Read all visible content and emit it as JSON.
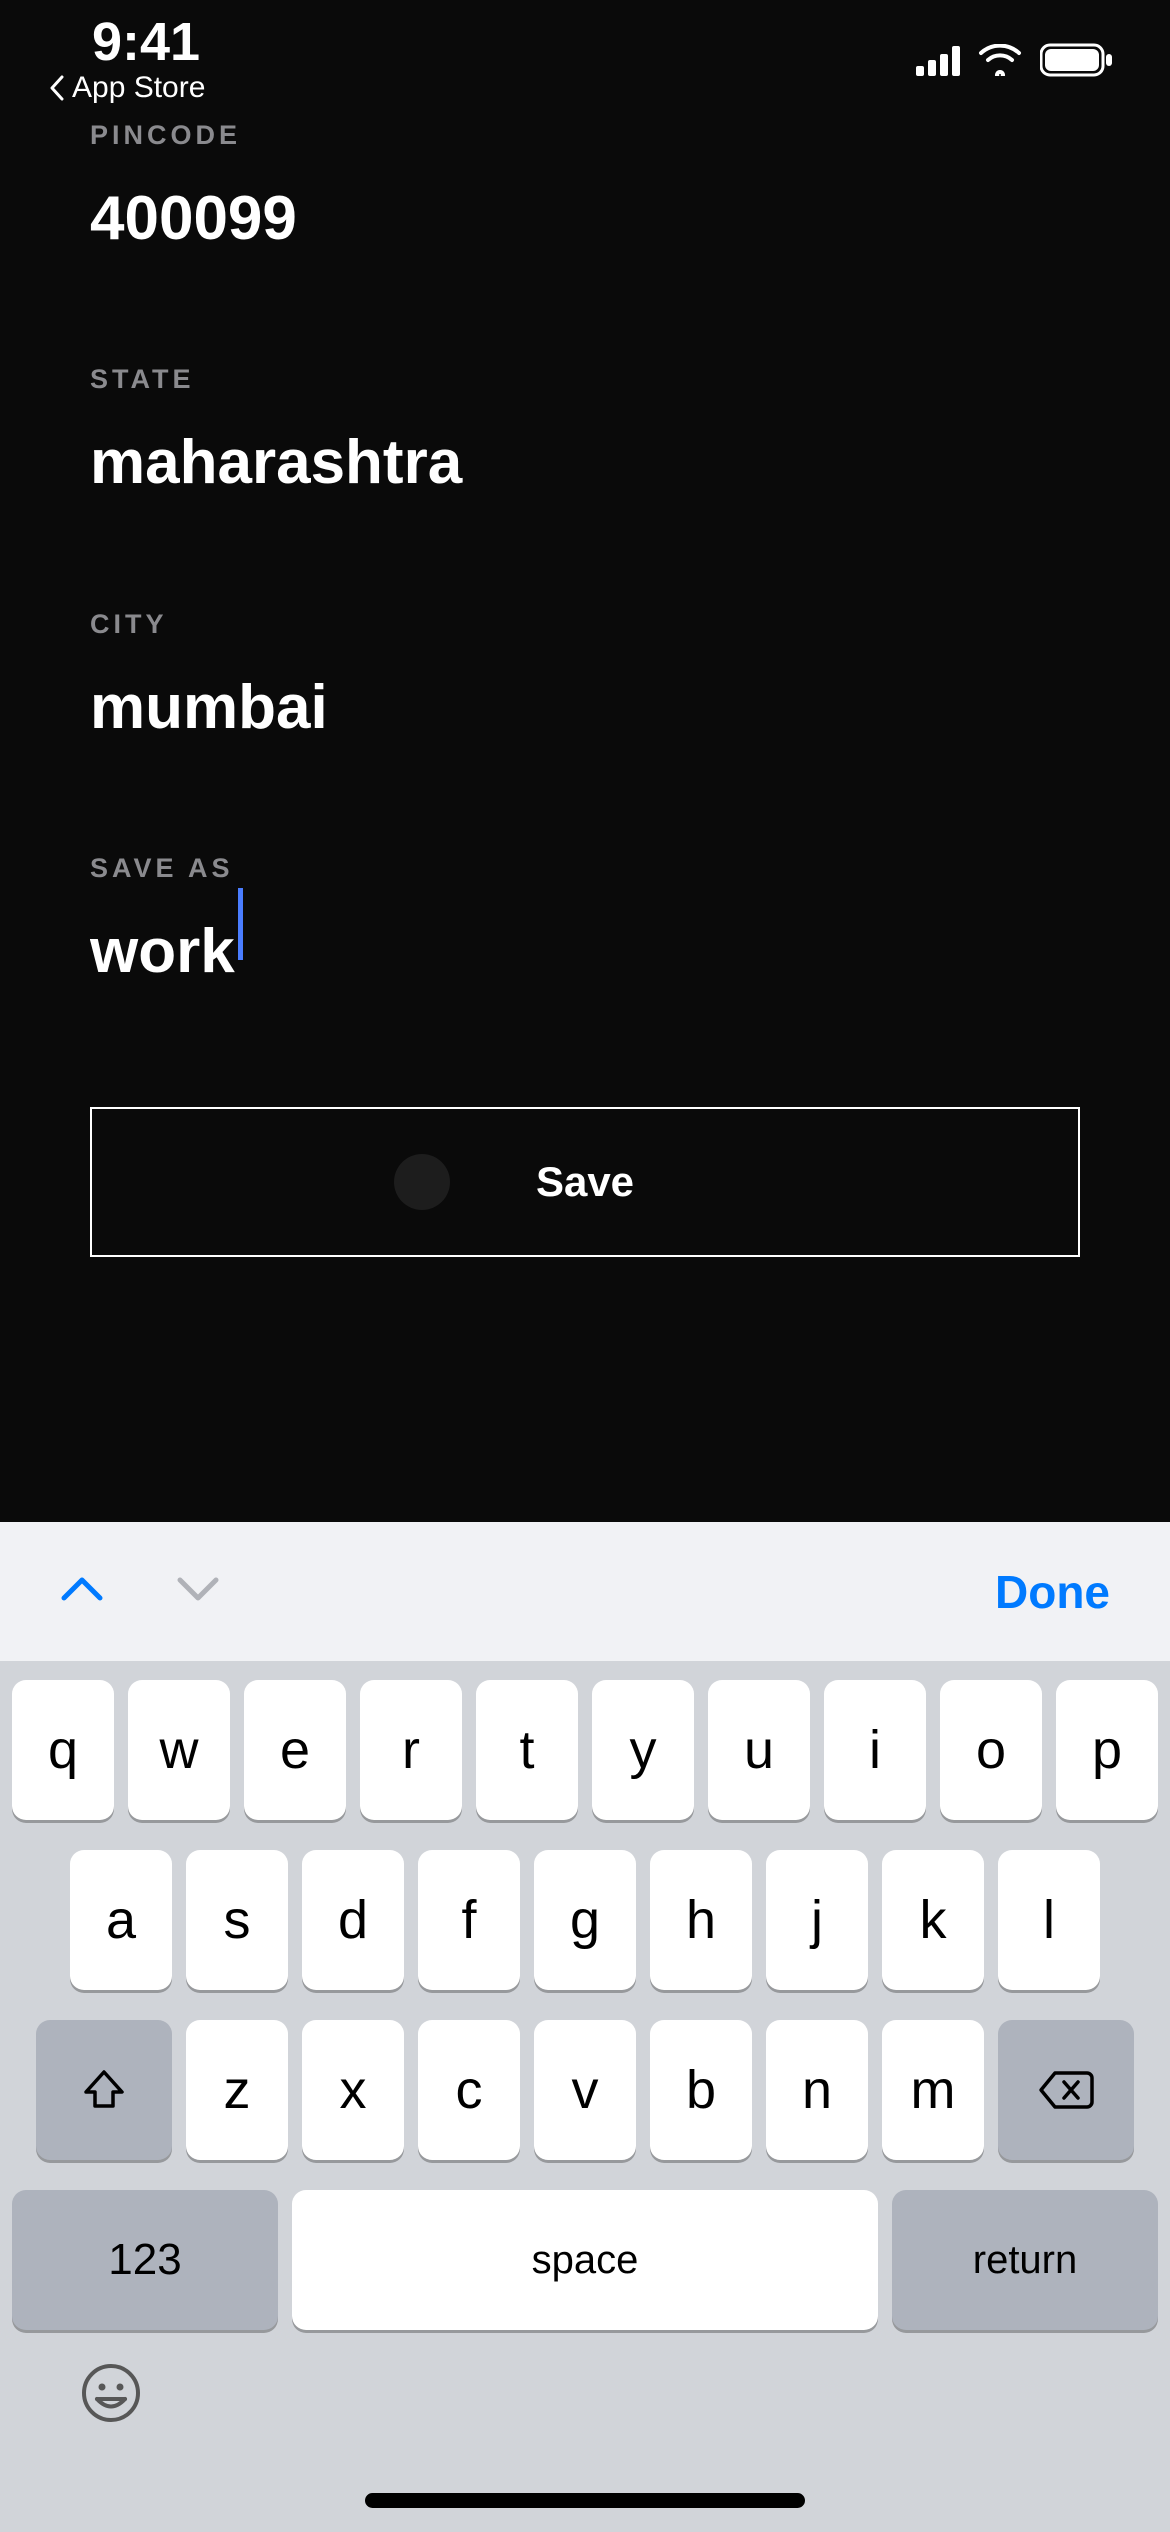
{
  "status": {
    "time": "9:41",
    "back_label": "App Store"
  },
  "form": {
    "pincode": {
      "label": "PINCODE",
      "value": "400099"
    },
    "state": {
      "label": "STATE",
      "value": "maharashtra"
    },
    "city": {
      "label": "CITY",
      "value": "mumbai"
    },
    "save_as": {
      "label": "SAVE AS",
      "value": "work"
    },
    "save_button": "Save"
  },
  "keyboard": {
    "accessory_done": "Done",
    "row1": [
      "q",
      "w",
      "e",
      "r",
      "t",
      "y",
      "u",
      "i",
      "o",
      "p"
    ],
    "row2": [
      "a",
      "s",
      "d",
      "f",
      "g",
      "h",
      "j",
      "k",
      "l"
    ],
    "row3": [
      "z",
      "x",
      "c",
      "v",
      "b",
      "n",
      "m"
    ],
    "key_123": "123",
    "key_space": "space",
    "key_return": "return"
  }
}
